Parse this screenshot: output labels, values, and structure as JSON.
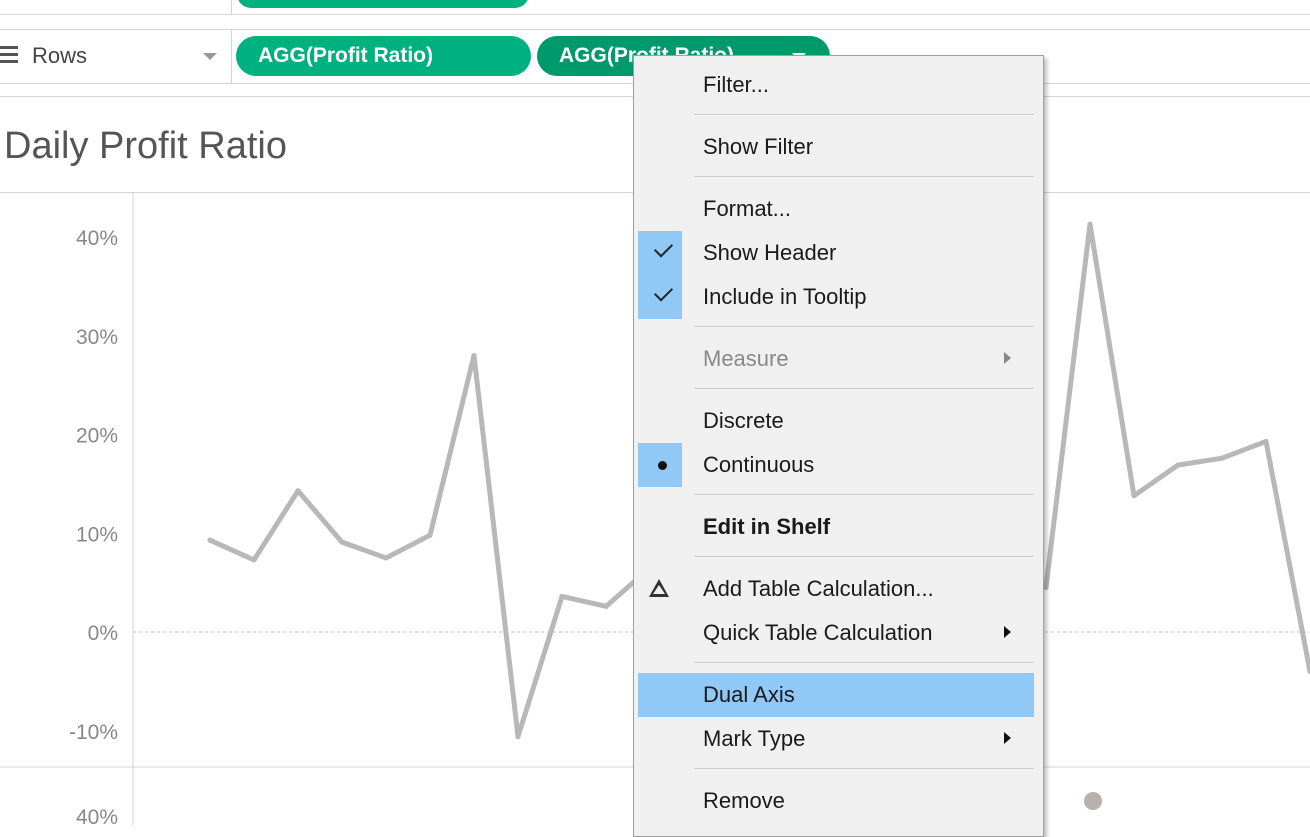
{
  "shelves": {
    "rows_label": "Rows",
    "pills": [
      "AGG(Profit Ratio)",
      "AGG(Profit Ratio)"
    ]
  },
  "chart_title": "Daily Profit Ratio",
  "context_menu": {
    "items": [
      {
        "label": "Filter...",
        "key": "filter"
      },
      {
        "label": "Show Filter",
        "key": "show_filter"
      },
      {
        "label": "Format...",
        "key": "format"
      },
      {
        "label": "Show Header",
        "key": "show_header",
        "checked": true
      },
      {
        "label": "Include in Tooltip",
        "key": "include_tooltip",
        "checked": true
      },
      {
        "label": "Measure",
        "key": "measure",
        "disabled": true,
        "submenu": true
      },
      {
        "label": "Discrete",
        "key": "discrete"
      },
      {
        "label": "Continuous",
        "key": "continuous",
        "selected": true
      },
      {
        "label": "Edit in Shelf",
        "key": "edit_in_shelf",
        "bold": true
      },
      {
        "label": "Add Table Calculation...",
        "key": "add_table_calc",
        "icon": "delta-icon"
      },
      {
        "label": "Quick Table Calculation",
        "key": "quick_table_calc",
        "submenu": true
      },
      {
        "label": "Dual Axis",
        "key": "dual_axis",
        "highlighted": true
      },
      {
        "label": "Mark Type",
        "key": "mark_type",
        "submenu": true
      },
      {
        "label": "Remove",
        "key": "remove"
      }
    ]
  },
  "colors": {
    "pill_green": "#00b180",
    "pill_green_dark": "#00996b",
    "line_grey": "#b8b8b8",
    "menu_highlight": "#90c8f6"
  },
  "chart_data": {
    "type": "line",
    "title": "Daily Profit Ratio",
    "xlabel": "",
    "ylabel": "",
    "y_ticks": [
      "40%",
      "30%",
      "20%",
      "10%",
      "0%",
      "-10%"
    ],
    "lower_axis_first_tick": "40%",
    "ylim": [
      -12,
      44
    ],
    "series": [
      {
        "values": [
          9.3,
          7.3,
          14.3,
          9.1,
          7.5,
          9.8,
          28.0,
          -10.6,
          3.6,
          2.6,
          6.5,
          null,
          null,
          null,
          null,
          null,
          null,
          null,
          null,
          4.5,
          41.3,
          13.8,
          16.9,
          17.6,
          19.3,
          -4.0
        ]
      }
    ],
    "grid": false,
    "zero_line": true
  }
}
